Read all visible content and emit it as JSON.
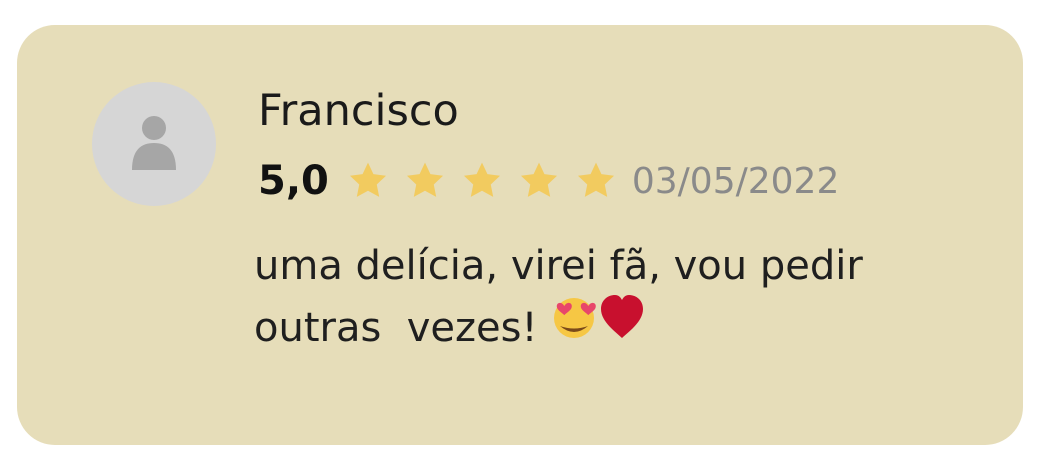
{
  "review": {
    "reviewer_name": "Francisco",
    "rating_value": "5,0",
    "rating": 5,
    "max_rating": 5,
    "date": "03/05/2022",
    "comment": "uma delícia, virei fã, vou pedir\noutras  vezes! "
  },
  "icons": {
    "avatar": "person-placeholder-icon",
    "star": "star-icon",
    "emoji_1": "heart-eyes-emoji-icon",
    "emoji_2": "red-heart-icon"
  },
  "colors": {
    "card_background": "#e6ddb9",
    "avatar_background": "#d6d6d6",
    "star": "#f2cb5f",
    "date": "#8a8a8a",
    "heart": "#c8102e"
  }
}
